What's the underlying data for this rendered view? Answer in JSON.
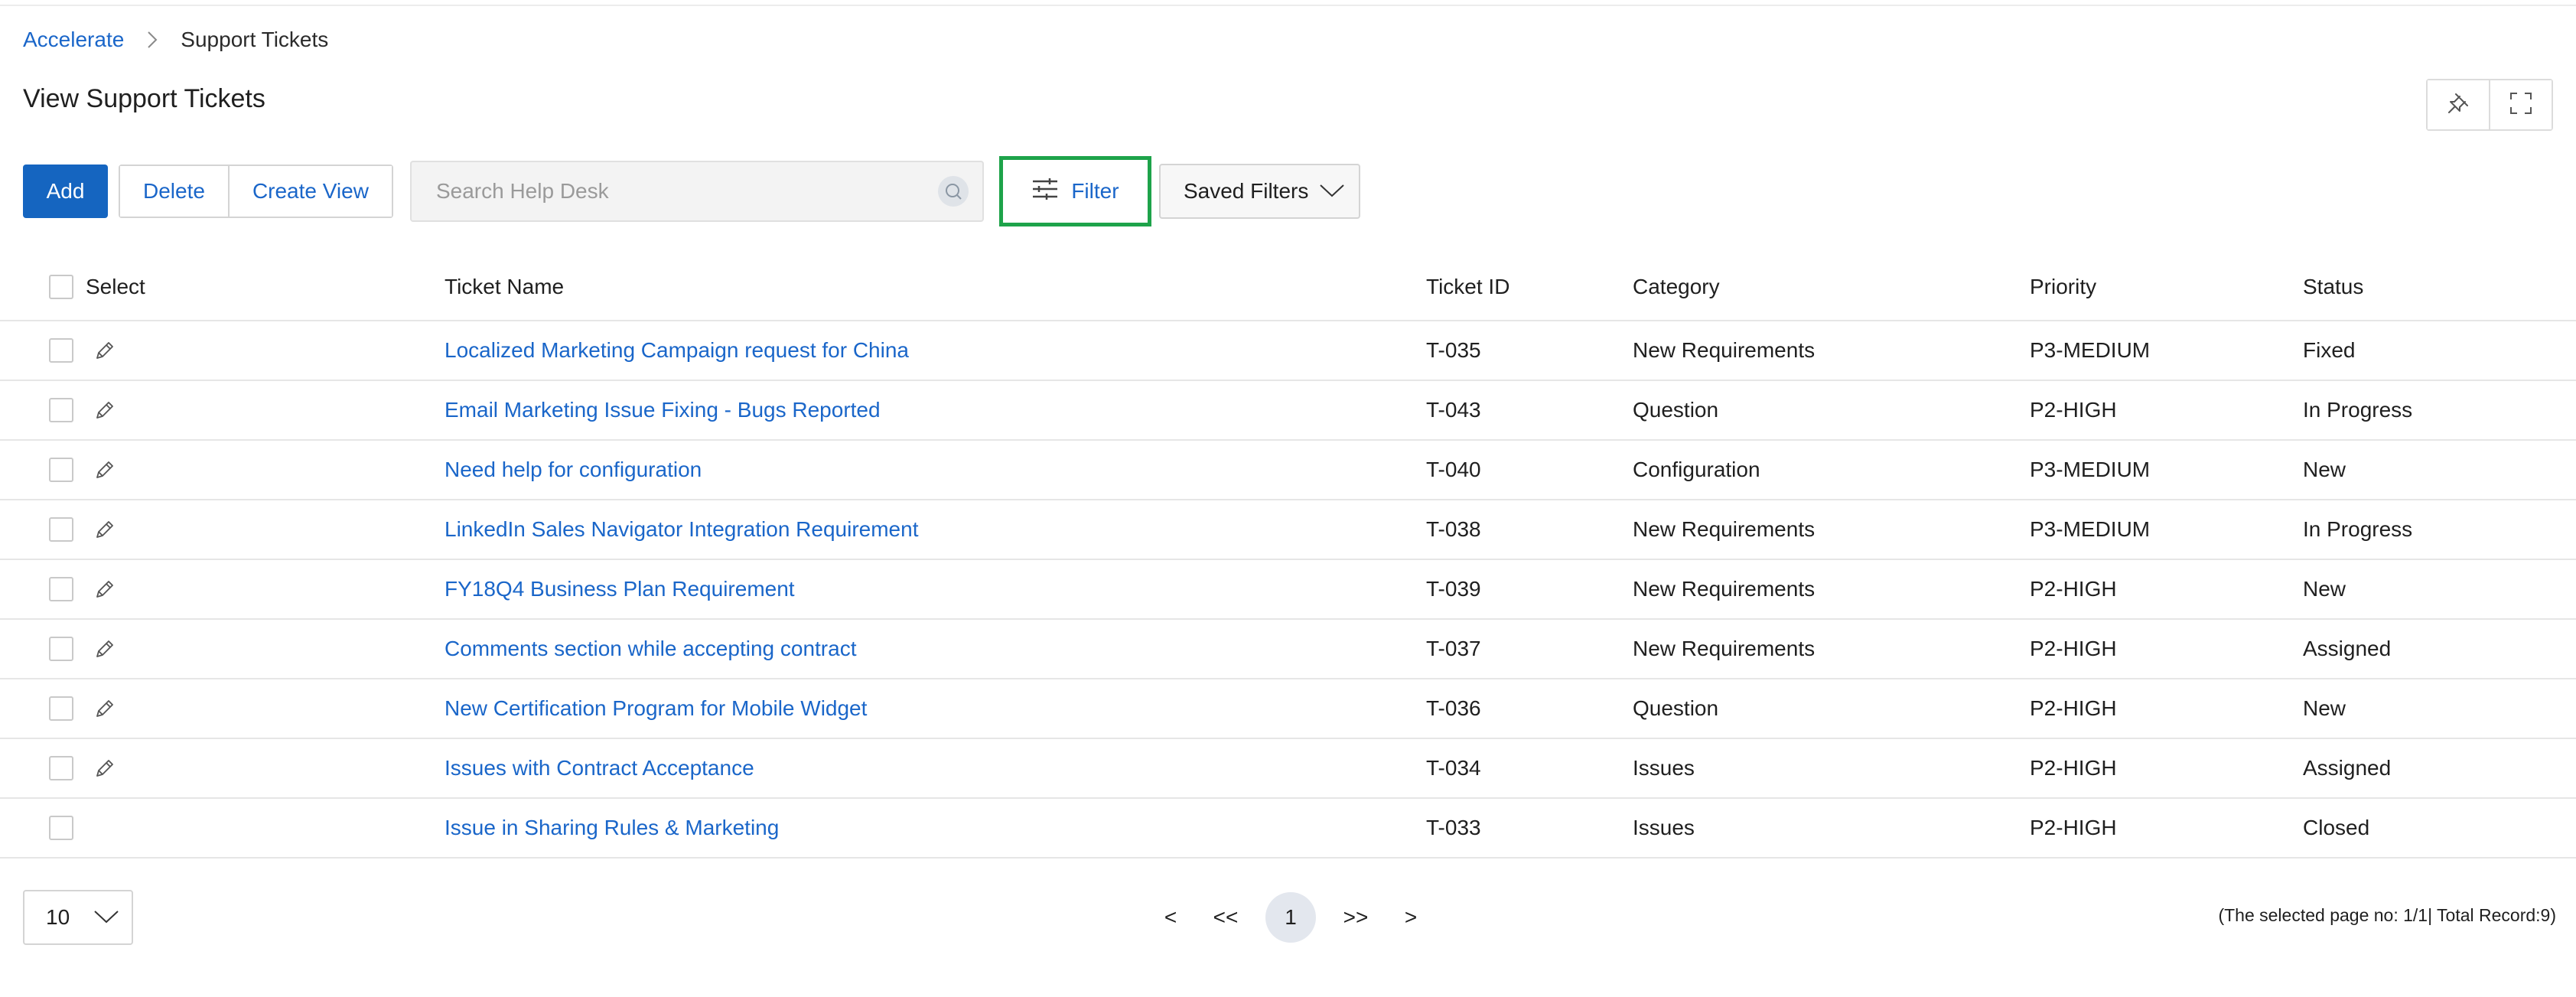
{
  "breadcrumb": {
    "root": "Accelerate",
    "current": "Support Tickets"
  },
  "page_title": "View Support Tickets",
  "toolbar": {
    "add_label": "Add",
    "delete_label": "Delete",
    "create_view_label": "Create View",
    "search_placeholder": "Search Help Desk",
    "filter_label": "Filter",
    "saved_filters_label": "Saved Filters"
  },
  "icons": {
    "pin": "pin-icon",
    "fullscreen": "fullscreen-icon",
    "search": "search-icon",
    "filter": "sliders-icon",
    "edit": "pencil-icon",
    "dropdown": "chevron-down-icon",
    "breadcrumb_separator": "chevron-right-icon"
  },
  "colors": {
    "accent": "#1565c0",
    "link": "#1a66c9",
    "filter_highlight": "#1ea34a"
  },
  "table": {
    "columns": [
      "Select",
      "Ticket Name",
      "Ticket ID",
      "Category",
      "Priority",
      "Status"
    ],
    "rows": [
      {
        "name": "Localized Marketing Campaign request for China",
        "id": "T-035",
        "category": "New Requirements",
        "priority": "P3-MEDIUM",
        "status": "Fixed",
        "editable": true
      },
      {
        "name": "Email Marketing Issue Fixing - Bugs Reported",
        "id": "T-043",
        "category": "Question",
        "priority": "P2-HIGH",
        "status": "In Progress",
        "editable": true
      },
      {
        "name": "Need help for configuration",
        "id": "T-040",
        "category": "Configuration",
        "priority": "P3-MEDIUM",
        "status": "New",
        "editable": true
      },
      {
        "name": "LinkedIn Sales Navigator Integration Requirement",
        "id": "T-038",
        "category": "New Requirements",
        "priority": "P3-MEDIUM",
        "status": "In Progress",
        "editable": true
      },
      {
        "name": "FY18Q4 Business Plan Requirement",
        "id": "T-039",
        "category": "New Requirements",
        "priority": "P2-HIGH",
        "status": "New",
        "editable": true
      },
      {
        "name": "Comments section while accepting contract",
        "id": "T-037",
        "category": "New Requirements",
        "priority": "P2-HIGH",
        "status": "Assigned",
        "editable": true
      },
      {
        "name": "New Certification Program for Mobile Widget",
        "id": "T-036",
        "category": "Question",
        "priority": "P2-HIGH",
        "status": "New",
        "editable": true
      },
      {
        "name": "Issues with Contract Acceptance",
        "id": "T-034",
        "category": "Issues",
        "priority": "P2-HIGH",
        "status": "Assigned",
        "editable": true
      },
      {
        "name": "Issue in Sharing Rules & Marketing",
        "id": "T-033",
        "category": "Issues",
        "priority": "P2-HIGH",
        "status": "Closed",
        "editable": false
      }
    ]
  },
  "footer": {
    "page_size": "10",
    "pager": {
      "prev": "<",
      "first": "<<",
      "current": "1",
      "last": ">>",
      "next": ">"
    },
    "summary": "(The selected page no: 1/1| Total Record:9)"
  }
}
